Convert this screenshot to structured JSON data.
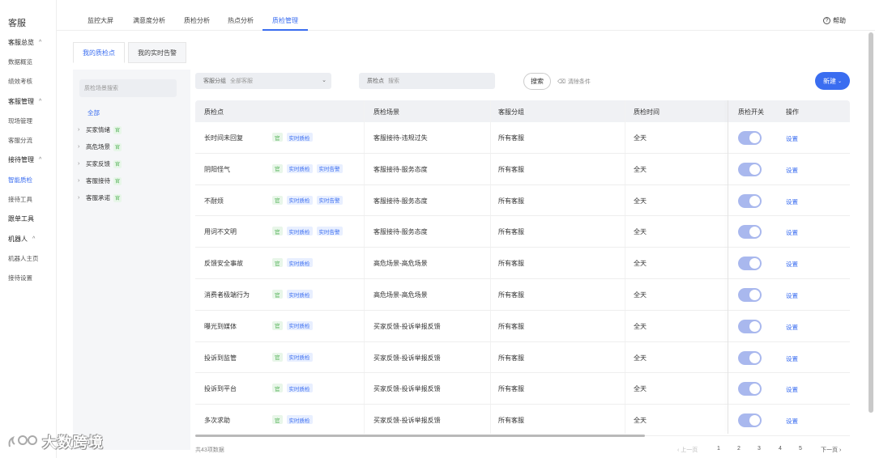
{
  "sidebar": {
    "brand": "客服",
    "items": [
      {
        "label": "客服总览",
        "type": "group",
        "chevron": "^"
      },
      {
        "label": "数据概览",
        "type": "child"
      },
      {
        "label": "绩效考核",
        "type": "child"
      },
      {
        "label": "客服管理",
        "type": "group",
        "chevron": "^"
      },
      {
        "label": "现场管理",
        "type": "child"
      },
      {
        "label": "客服分流",
        "type": "child"
      },
      {
        "label": "接待管理",
        "type": "group",
        "chevron": "^"
      },
      {
        "label": "智能质检",
        "type": "child",
        "active": true
      },
      {
        "label": "接待工具",
        "type": "child"
      },
      {
        "label": "跟单工具",
        "type": "group"
      },
      {
        "label": "机器人",
        "type": "group",
        "chevron": "^"
      },
      {
        "label": "机器人主页",
        "type": "child"
      },
      {
        "label": "接待设置",
        "type": "child"
      }
    ]
  },
  "top_tabs": [
    "监控大屏",
    "满意度分析",
    "质检分析",
    "热点分析",
    "质检管理"
  ],
  "active_top_tab": "质检管理",
  "help": "帮助",
  "sub_tabs": [
    "我的质检点",
    "我的实时告警"
  ],
  "tree": {
    "search_placeholder": "质检场景搜索",
    "all": "全部",
    "items": [
      {
        "label": "买家情绪",
        "tag": "官"
      },
      {
        "label": "高危场景",
        "tag": "官"
      },
      {
        "label": "买家反馈",
        "tag": "官"
      },
      {
        "label": "客服接待",
        "tag": "官"
      },
      {
        "label": "客服承诺",
        "tag": "官"
      }
    ]
  },
  "filters": {
    "group_label": "客服分组",
    "group_value": "全部客服",
    "point_label": "质检点",
    "point_placeholder": "搜索",
    "search_button": "搜索",
    "clear": "清除条件",
    "new_button": "新建"
  },
  "table": {
    "headers": [
      "质检点",
      "质检场景",
      "客服分组",
      "质检时间",
      "质检开关",
      "操作"
    ],
    "rows": [
      {
        "name": "长时间未回复",
        "tags": [
          "官",
          "实时质检"
        ],
        "scene": "客服接待-违规过失",
        "group": "所有客服",
        "time": "全天",
        "action": "设置"
      },
      {
        "name": "阴阳怪气",
        "tags": [
          "官",
          "实时质检",
          "实时告警"
        ],
        "scene": "客服接待-服务态度",
        "group": "所有客服",
        "time": "全天",
        "action": "设置"
      },
      {
        "name": "不耐烦",
        "tags": [
          "官",
          "实时质检",
          "实时告警"
        ],
        "scene": "客服接待-服务态度",
        "group": "所有客服",
        "time": "全天",
        "action": "设置"
      },
      {
        "name": "用词不文明",
        "tags": [
          "官",
          "实时质检",
          "实时告警"
        ],
        "scene": "客服接待-服务态度",
        "group": "所有客服",
        "time": "全天",
        "action": "设置"
      },
      {
        "name": "反馈安全事故",
        "tags": [
          "官",
          "实时质检"
        ],
        "scene": "高危场景-高危场景",
        "group": "所有客服",
        "time": "全天",
        "action": "设置"
      },
      {
        "name": "消费者极端行为",
        "tags": [
          "官",
          "实时质检"
        ],
        "scene": "高危场景-高危场景",
        "group": "所有客服",
        "time": "全天",
        "action": "设置"
      },
      {
        "name": "曝光到媒体",
        "tags": [
          "官",
          "实时质检"
        ],
        "scene": "买家反馈-投诉举报反馈",
        "group": "所有客服",
        "time": "全天",
        "action": "设置"
      },
      {
        "name": "投诉到监管",
        "tags": [
          "官",
          "实时质检"
        ],
        "scene": "买家反馈-投诉举报反馈",
        "group": "所有客服",
        "time": "全天",
        "action": "设置"
      },
      {
        "name": "投诉到平台",
        "tags": [
          "官",
          "实时质检"
        ],
        "scene": "买家反馈-投诉举报反馈",
        "group": "所有客服",
        "time": "全天",
        "action": "设置"
      },
      {
        "name": "多次求助",
        "tags": [
          "官",
          "实时质检"
        ],
        "scene": "买家反馈-投诉举报反馈",
        "group": "所有客服",
        "time": "全天",
        "action": "设置"
      }
    ]
  },
  "pagination": {
    "total": "共43项数据",
    "prev": "‹ 上一页",
    "pages": [
      "1",
      "2",
      "3",
      "4",
      "5"
    ],
    "next": "下一页 ›"
  },
  "watermark": "大数跨境",
  "colors": {
    "accent": "#3a6df0",
    "guan_tag": "#4caf50",
    "toggle_on": "#a9b8ee"
  }
}
